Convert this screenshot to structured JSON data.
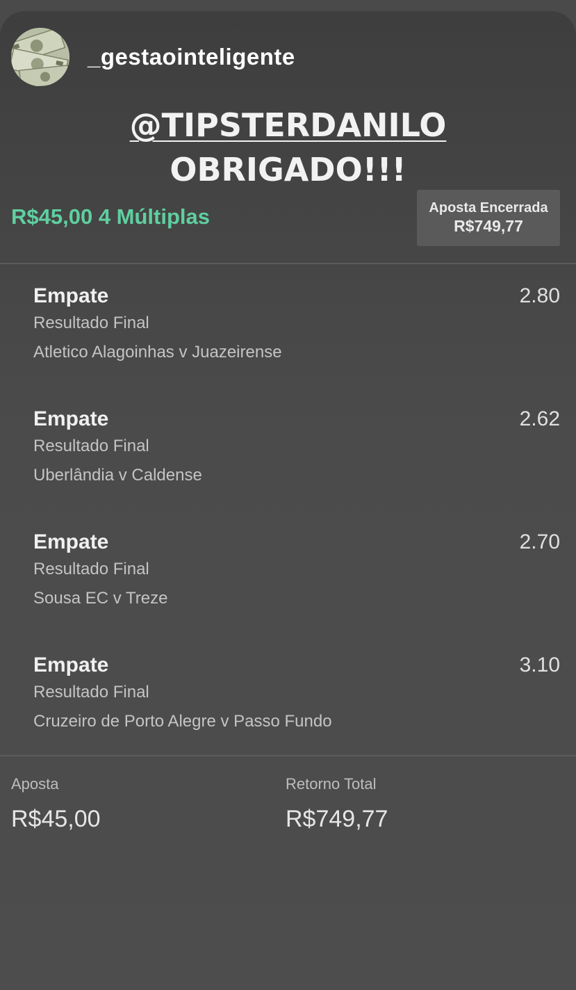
{
  "story": {
    "username": "_gestaointeligente",
    "avatar_icon": "money-bills-icon"
  },
  "caption": {
    "mention": "@TIPSTERDANILO",
    "message": "OBRIGADO!!!"
  },
  "bet": {
    "summary": "R$45,00 4 Múltiplas",
    "status_label": "Aposta Encerrada",
    "status_amount": "R$749,77",
    "accent_color": "#5fcfa0",
    "selections": [
      {
        "outcome": "Empate",
        "odds": "2.80",
        "market": "Resultado Final",
        "event": "Atletico Alagoinhas v Juazeirense"
      },
      {
        "outcome": "Empate",
        "odds": "2.62",
        "market": "Resultado Final",
        "event": "Uberlândia v Caldense"
      },
      {
        "outcome": "Empate",
        "odds": "2.70",
        "market": "Resultado Final",
        "event": "Sousa EC v Treze"
      },
      {
        "outcome": "Empate",
        "odds": "3.10",
        "market": "Resultado Final",
        "event": "Cruzeiro de Porto Alegre v Passo Fundo"
      }
    ],
    "stake_label": "Aposta",
    "stake_value": "R$45,00",
    "return_label": "Retorno Total",
    "return_value": "R$749,77"
  }
}
